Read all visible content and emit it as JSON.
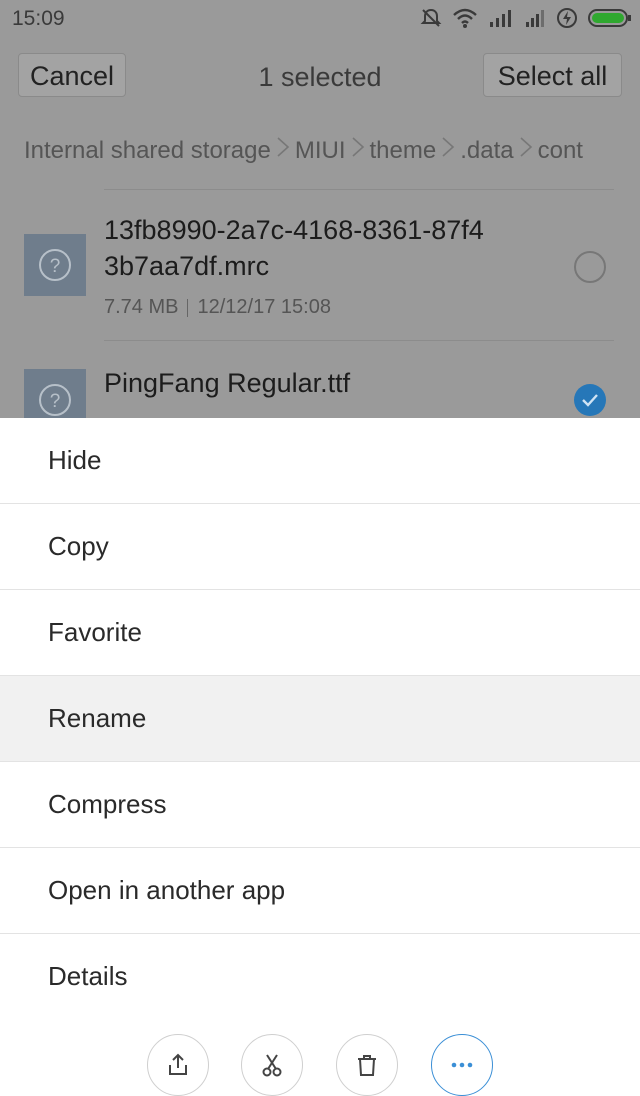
{
  "status_bar": {
    "time": "15:09",
    "icons": [
      "mute-icon",
      "wifi-icon",
      "signal-icon",
      "signal-icon",
      "charging-icon",
      "battery-icon"
    ]
  },
  "header": {
    "cancel_label": "Cancel",
    "title": "1 selected",
    "select_all_label": "Select all"
  },
  "breadcrumb": [
    "Internal shared storage",
    "MIUI",
    "theme",
    ".data",
    "cont"
  ],
  "files": [
    {
      "name_line1": "13fb8990-2a7c-4168-8361-87f4",
      "name_line2": "3b7aa7df.mrc",
      "size": "7.74 MB",
      "date": "12/12/17 15:08",
      "selected": false,
      "icon": "unknown-file-icon"
    },
    {
      "name_line1": "PingFang Regular.ttf",
      "selected": true,
      "icon": "unknown-file-icon"
    }
  ],
  "menu": {
    "items": [
      "Hide",
      "Copy",
      "Favorite",
      "Rename",
      "Compress",
      "Open in another app",
      "Details"
    ]
  },
  "toolbar": {
    "buttons": [
      "share-icon",
      "cut-icon",
      "delete-icon",
      "more-icon"
    ]
  },
  "colors": {
    "accent": "#2677b8",
    "dim_overlay": "#9a9a9a",
    "active_tool_border": "#3b8fd6"
  }
}
